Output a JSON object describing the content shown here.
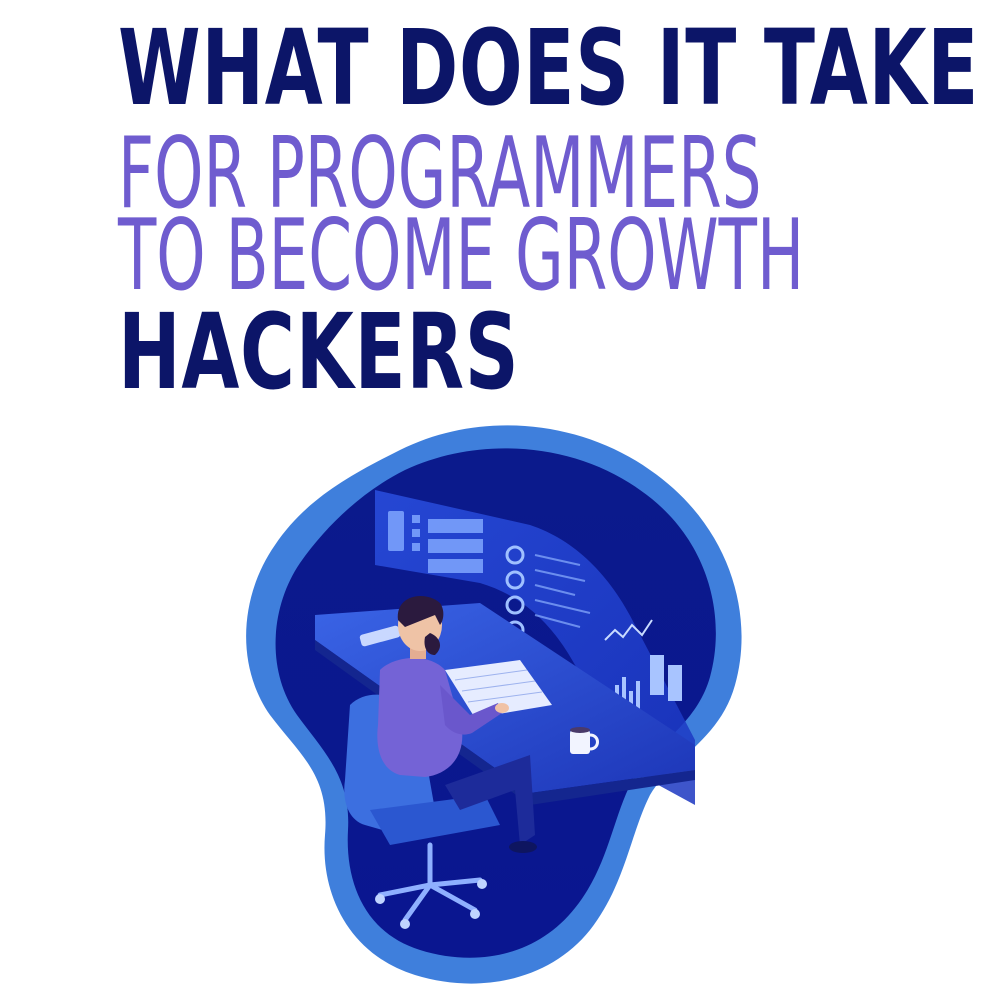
{
  "headline": {
    "line1": "WHAT DOES IT TAKE",
    "line2": "FOR PROGRAMMERS",
    "line3": "TO BECOME GROWTH",
    "line4": "HACKERS"
  },
  "colors": {
    "navy": "#0c1568",
    "purple": "#6f5ccf",
    "blob_outer": "#3f7fdc",
    "blob_inner": "#1a2aa8",
    "screen_glow": "#5b8cff"
  },
  "illustration": {
    "subject": "programmer-at-desk-icon"
  }
}
